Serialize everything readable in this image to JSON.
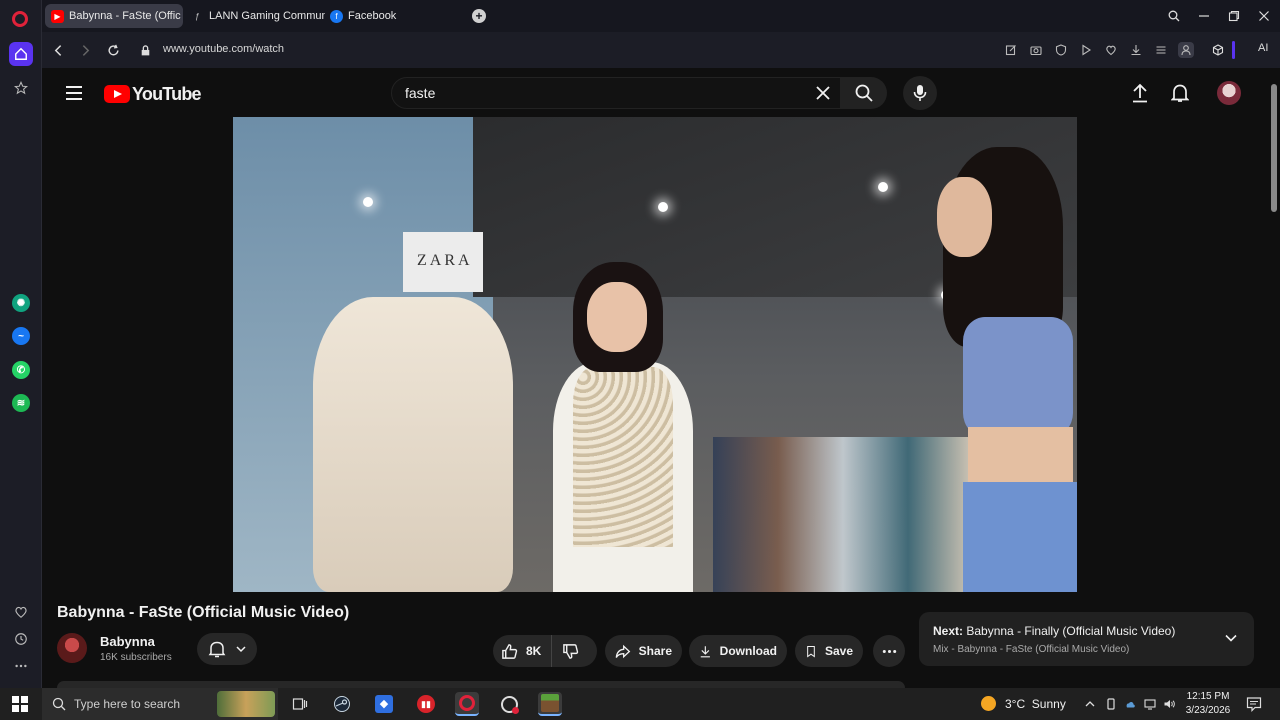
{
  "browser": {
    "tabs": [
      {
        "label": "Babynna - FaSte (Offic",
        "active": true,
        "icon": "youtube-icon"
      },
      {
        "label": "LANN Gaming Communit",
        "active": false,
        "icon": "lann-icon"
      },
      {
        "label": "Facebook",
        "active": false,
        "icon": "facebook-icon"
      }
    ],
    "new_tab_symbol": "+",
    "url": "www.youtube.com/watch",
    "ai_label": "AI"
  },
  "youtube": {
    "logo_text": "YouTube",
    "search_value": "faste",
    "video": {
      "title": "Babynna - FaSte (Official Music Video)",
      "sign_text": "ZARA"
    },
    "channel": {
      "name": "Babynna",
      "subscribers": "16K subscribers"
    },
    "actions": {
      "like_count": "8K",
      "share_label": "Share",
      "download_label": "Download",
      "save_label": "Save"
    },
    "next": {
      "prefix": "Next:",
      "title": "Babynna - Finally (Official Music Video)",
      "subtitle": "Mix - Babynna - FaSte (Official Music Video)"
    }
  },
  "taskbar": {
    "search_placeholder": "Type here to search",
    "weather": "3°C  Sunny",
    "time": "12:15 PM",
    "date": "3/23/2026"
  },
  "colors": {
    "youtube_red": "#ff0000",
    "opera_red": "#e0223a",
    "opera_accent": "#5a33f0",
    "bg": "#0f0f0f"
  }
}
